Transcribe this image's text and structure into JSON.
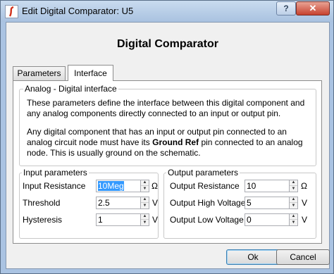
{
  "window": {
    "title": "Edit Digital Comparator: U5",
    "help_label": "?",
    "close_label": "✕"
  },
  "heading": "Digital Comparator",
  "tabs": [
    {
      "label": "Parameters",
      "selected": false
    },
    {
      "label": "Interface",
      "selected": true
    }
  ],
  "analog_group": {
    "title": "Analog - Digital interface",
    "paragraph1": "These parameters define the interface between this digital component and any analog components directly connected to an input or output pin.",
    "paragraph2_pre": "Any digital component that has an input or output pin connected to an analog circuit node must have its ",
    "paragraph2_bold": "Ground Ref",
    "paragraph2_post": " pin connected to an analog node. This is usually ground on the schematic."
  },
  "input_params": {
    "title": "Input parameters",
    "rows": [
      {
        "label": "Input Resistance",
        "value": "10Meg",
        "unit": "Ω"
      },
      {
        "label": "Threshold",
        "value": "2.5",
        "unit": "V"
      },
      {
        "label": "Hysteresis",
        "value": "1",
        "unit": "V"
      }
    ]
  },
  "output_params": {
    "title": "Output parameters",
    "rows": [
      {
        "label": "Output Resistance",
        "value": "10",
        "unit": "Ω"
      },
      {
        "label": "Output High Voltage",
        "value": "5",
        "unit": "V"
      },
      {
        "label": "Output Low Voltage",
        "value": "0",
        "unit": "V"
      }
    ]
  },
  "buttons": {
    "ok": "Ok",
    "cancel": "Cancel"
  },
  "spinner": {
    "up": "▲",
    "down": "▼"
  },
  "colors": {
    "title_gradient": "#b4cbe6",
    "close_red": "#c7422f",
    "selection": "#3399ff"
  },
  "icons": {
    "app": "simetrix-logo-icon"
  }
}
